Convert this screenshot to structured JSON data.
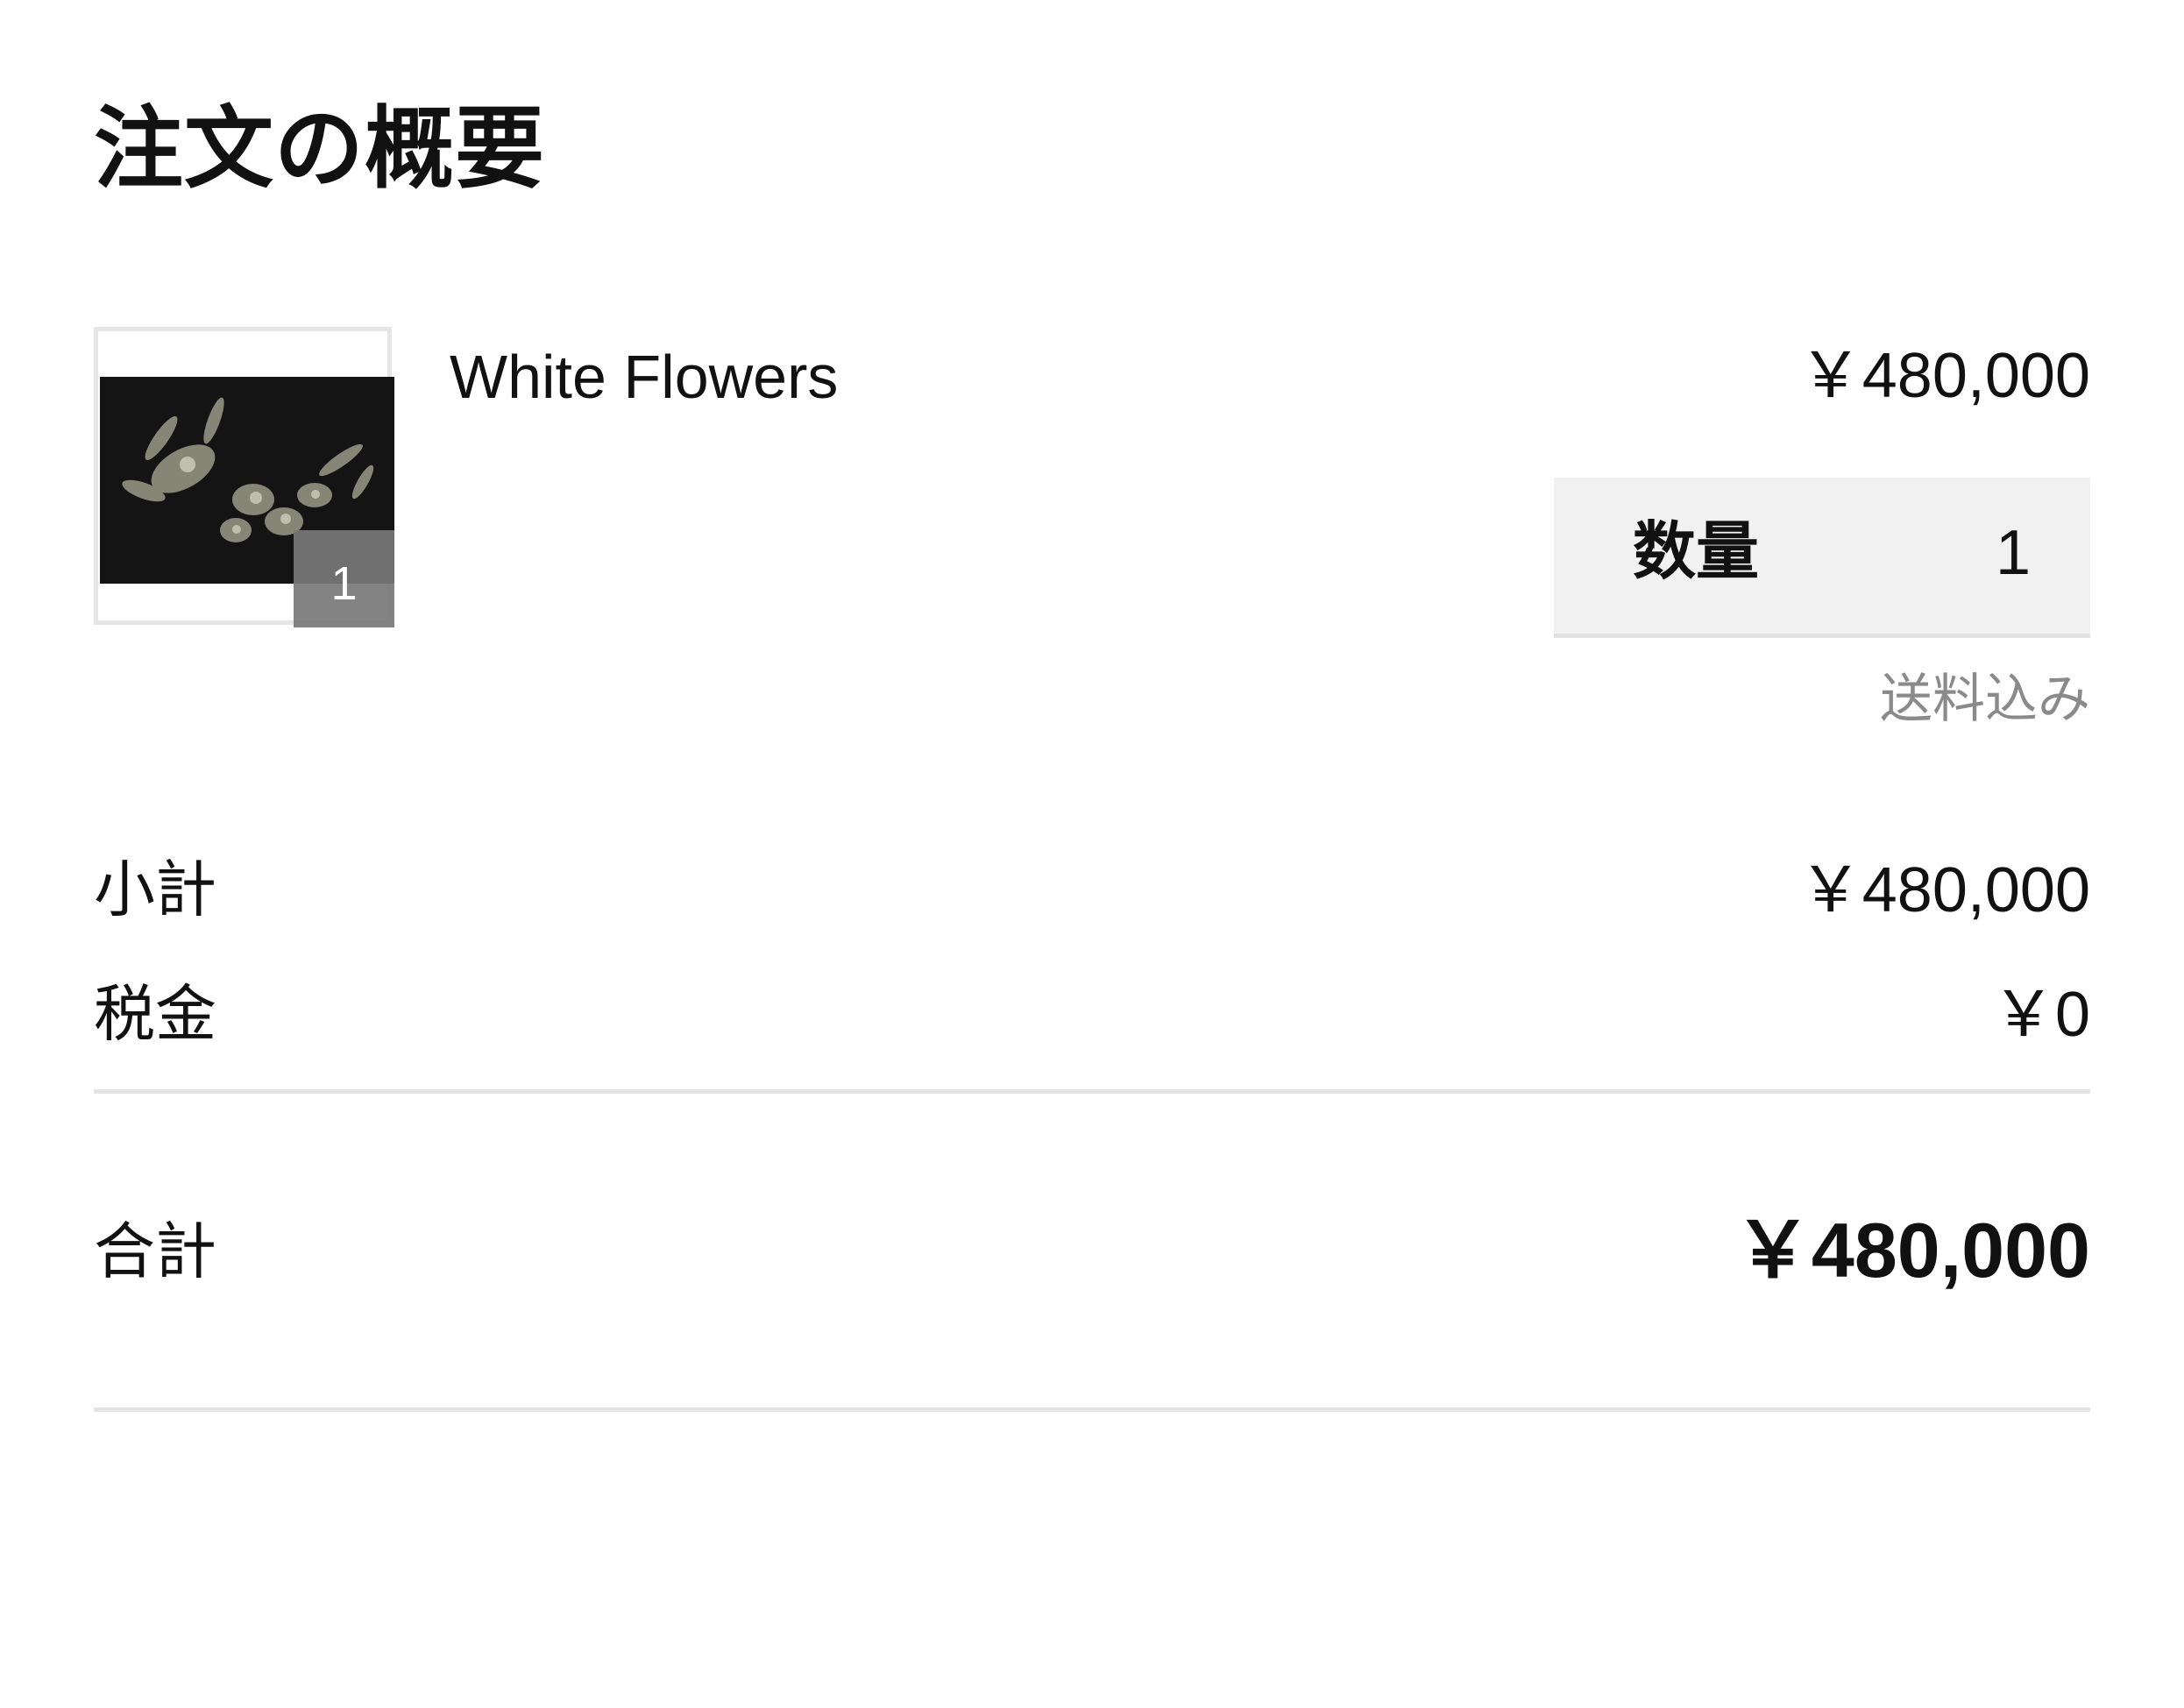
{
  "summary": {
    "heading": "注文の概要"
  },
  "item": {
    "name": "White Flowers",
    "price": "￥480,000",
    "badge_count": "1",
    "quantity_label": "数量",
    "quantity_value": "1",
    "shipping_note": "送料込み"
  },
  "totals": {
    "subtotal_label": "小計",
    "subtotal_value": "￥480,000",
    "tax_label": "税金",
    "tax_value": "￥0",
    "total_label": "合計",
    "total_value": "￥480,000"
  }
}
